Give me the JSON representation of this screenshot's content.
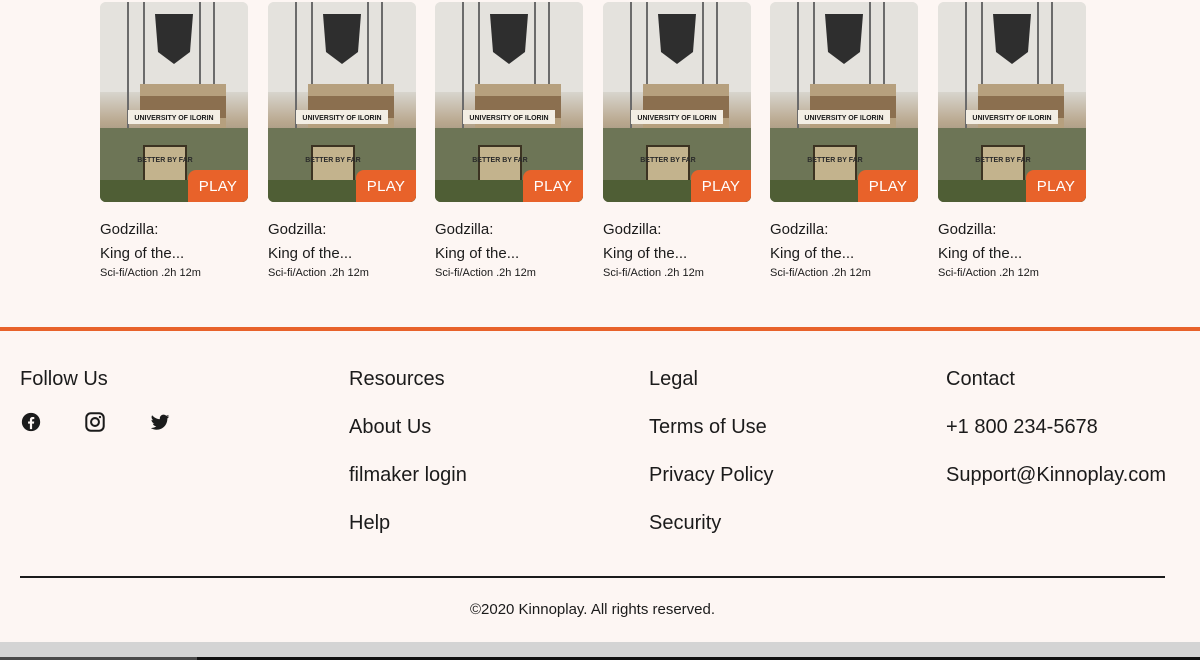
{
  "movies": [
    {
      "title_line1": "Godzilla:",
      "title_line2": "King of the...",
      "meta": "Sci-fi/Action .2h 12m",
      "play_label": "PLAY",
      "poster_sign": "UNIVERSITY OF ILORIN",
      "poster_stone": "BETTER BY FAR"
    },
    {
      "title_line1": "Godzilla:",
      "title_line2": "King of the...",
      "meta": "Sci-fi/Action .2h 12m",
      "play_label": "PLAY",
      "poster_sign": "UNIVERSITY OF ILORIN",
      "poster_stone": "BETTER BY FAR"
    },
    {
      "title_line1": "Godzilla:",
      "title_line2": "King of the...",
      "meta": "Sci-fi/Action .2h 12m",
      "play_label": "PLAY",
      "poster_sign": "UNIVERSITY OF ILORIN",
      "poster_stone": "BETTER BY FAR"
    },
    {
      "title_line1": "Godzilla:",
      "title_line2": "King of the...",
      "meta": "Sci-fi/Action .2h 12m",
      "play_label": "PLAY",
      "poster_sign": "UNIVERSITY OF ILORIN",
      "poster_stone": "BETTER BY FAR"
    },
    {
      "title_line1": "Godzilla:",
      "title_line2": "King of the...",
      "meta": "Sci-fi/Action .2h 12m",
      "play_label": "PLAY",
      "poster_sign": "UNIVERSITY OF ILORIN",
      "poster_stone": "BETTER BY FAR"
    },
    {
      "title_line1": "Godzilla:",
      "title_line2": "King of the...",
      "meta": "Sci-fi/Action .2h 12m",
      "play_label": "PLAY",
      "poster_sign": "UNIVERSITY OF ILORIN",
      "poster_stone": "BETTER BY FAR"
    }
  ],
  "footer": {
    "follow": {
      "heading": "Follow Us",
      "icons": [
        "facebook-icon",
        "instagram-icon",
        "twitter-icon"
      ]
    },
    "resources": {
      "heading": "Resources",
      "links": [
        "About Us",
        "filmaker login",
        "Help"
      ]
    },
    "legal": {
      "heading": "Legal",
      "links": [
        "Terms of Use",
        "Privacy Policy",
        "Security"
      ]
    },
    "contact": {
      "heading": "Contact",
      "phone": "+1 800 234-5678",
      "email": "Support@Kinnoplay.com"
    },
    "copyright": "©2020 Kinnoplay. All rights reserved."
  },
  "colors": {
    "accent": "#e8622a",
    "background": "#fdf6f3",
    "text": "#1b1b1b"
  }
}
